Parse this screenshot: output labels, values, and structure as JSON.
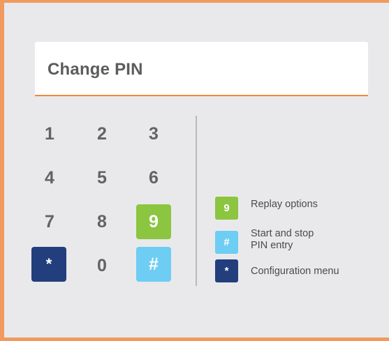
{
  "title": "Change PIN",
  "keypad": {
    "keys": [
      "1",
      "2",
      "3",
      "4",
      "5",
      "6",
      "7",
      "8",
      "9",
      "*",
      "0",
      "#"
    ]
  },
  "legend": {
    "items": [
      {
        "symbol": "9",
        "label": "Replay options",
        "color": "#8cc53f"
      },
      {
        "symbol": "#",
        "label_line1": "Start and stop",
        "label_line2": "PIN entry",
        "color": "#6dcdf2"
      },
      {
        "symbol": "*",
        "label": "Configuration menu",
        "color": "#223e7c"
      }
    ]
  },
  "colors": {
    "accent_orange": "#f0883e",
    "green": "#8cc53f",
    "light_blue": "#6dcdf2",
    "navy": "#223e7c"
  }
}
